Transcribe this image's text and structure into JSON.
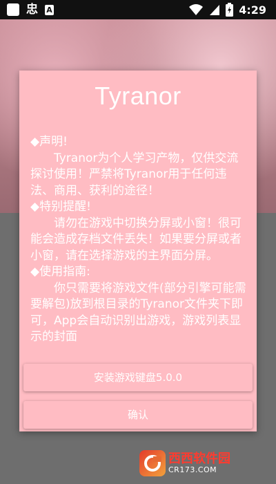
{
  "status_bar": {
    "glyph": "忠",
    "badge": "A",
    "time": "4:29",
    "icons": [
      "notification-square-icon",
      "app-notification-icon",
      "a-badge-icon",
      "wifi-icon",
      "signal-icon",
      "battery-charging-icon"
    ]
  },
  "dialog": {
    "title": "Tyranor",
    "paragraphs": [
      {
        "text": "◆声明!",
        "indent": false
      },
      {
        "text": "Tyranor为个人学习产物，仅供交流探讨使用！严禁将Tyranor用于任何违法、商用、获利的途径！",
        "indent": true
      },
      {
        "text": "◆特别提醒!",
        "indent": false
      },
      {
        "text": "请勿在游戏中切换分屏或小窗！很可能会造成存档文件丢失！如果要分屏或者小窗，请在选择游戏的主界面分屏。",
        "indent": true
      },
      {
        "text": "◆使用指南:",
        "indent": false
      },
      {
        "text": "你只需要将游戏文件(部分引擎可能需要解包)放到根目录的Tyranor文件夹下即可，App会自动识别出游戏，游戏列表显示的封面",
        "indent": true
      }
    ],
    "buttons": {
      "keyboard": "安装游戏键盘5.0.0",
      "confirm": "确认"
    }
  },
  "watermark": {
    "name": "西西软件园",
    "url": "CR173.COM"
  },
  "colors": {
    "dialog_bg": "#ffbcc3",
    "text": "#ffffff",
    "status_bar": "#111111"
  }
}
